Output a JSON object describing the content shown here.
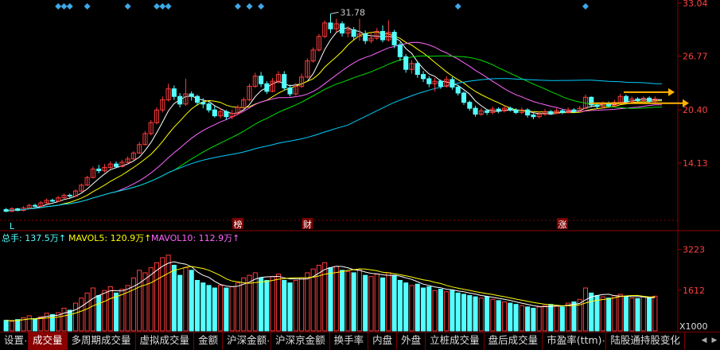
{
  "chart_data": {
    "type": "candlestick",
    "price_axis": {
      "ticks": [
        "33.04",
        "26.77",
        "20.40",
        "14.13"
      ],
      "ylim": [
        7.8,
        33.04
      ]
    },
    "max_label": "31.78",
    "event_markers": [
      "榜",
      "财",
      "涨"
    ],
    "left_marker": "L",
    "diamond_count": 13,
    "candles": [
      {
        "o": 8.6,
        "c": 8.4,
        "h": 8.8,
        "l": 8.3
      },
      {
        "o": 8.4,
        "c": 8.7,
        "h": 8.9,
        "l": 8.3
      },
      {
        "o": 8.7,
        "c": 8.5,
        "h": 8.8,
        "l": 8.4
      },
      {
        "o": 8.5,
        "c": 8.8,
        "h": 9.0,
        "l": 8.4
      },
      {
        "o": 8.8,
        "c": 9.1,
        "h": 9.3,
        "l": 8.7
      },
      {
        "o": 9.1,
        "c": 9.0,
        "h": 9.3,
        "l": 8.9
      },
      {
        "o": 9.0,
        "c": 9.4,
        "h": 9.6,
        "l": 8.9
      },
      {
        "o": 9.4,
        "c": 9.7,
        "h": 9.9,
        "l": 9.3
      },
      {
        "o": 9.7,
        "c": 9.6,
        "h": 9.9,
        "l": 9.5
      },
      {
        "o": 9.6,
        "c": 10.0,
        "h": 10.2,
        "l": 9.5
      },
      {
        "o": 10.0,
        "c": 10.3,
        "h": 10.5,
        "l": 9.9
      },
      {
        "o": 10.3,
        "c": 10.2,
        "h": 10.5,
        "l": 10.0
      },
      {
        "o": 10.2,
        "c": 10.8,
        "h": 11.0,
        "l": 10.1
      },
      {
        "o": 10.8,
        "c": 11.5,
        "h": 11.7,
        "l": 10.7
      },
      {
        "o": 11.5,
        "c": 12.4,
        "h": 12.6,
        "l": 11.4
      },
      {
        "o": 12.4,
        "c": 13.4,
        "h": 13.7,
        "l": 12.3
      },
      {
        "o": 13.4,
        "c": 13.2,
        "h": 13.9,
        "l": 12.9
      },
      {
        "o": 13.2,
        "c": 13.6,
        "h": 14.0,
        "l": 13.0
      },
      {
        "o": 13.6,
        "c": 14.0,
        "h": 14.3,
        "l": 13.4
      },
      {
        "o": 14.0,
        "c": 13.7,
        "h": 14.3,
        "l": 13.5
      },
      {
        "o": 13.7,
        "c": 14.2,
        "h": 14.5,
        "l": 13.6
      },
      {
        "o": 14.2,
        "c": 14.6,
        "h": 14.9,
        "l": 14.0
      },
      {
        "o": 14.6,
        "c": 15.3,
        "h": 15.5,
        "l": 14.5
      },
      {
        "o": 15.3,
        "c": 16.3,
        "h": 16.6,
        "l": 15.2
      },
      {
        "o": 16.3,
        "c": 17.6,
        "h": 17.9,
        "l": 16.2
      },
      {
        "o": 17.6,
        "c": 18.9,
        "h": 19.2,
        "l": 17.4
      },
      {
        "o": 18.9,
        "c": 20.4,
        "h": 20.7,
        "l": 18.7
      },
      {
        "o": 20.4,
        "c": 21.6,
        "h": 22.0,
        "l": 20.1
      },
      {
        "o": 21.6,
        "c": 22.9,
        "h": 23.5,
        "l": 21.4
      },
      {
        "o": 22.9,
        "c": 22.0,
        "h": 23.3,
        "l": 21.6
      },
      {
        "o": 22.0,
        "c": 21.1,
        "h": 22.4,
        "l": 20.7
      },
      {
        "o": 21.1,
        "c": 22.3,
        "h": 24.1,
        "l": 20.9
      },
      {
        "o": 22.3,
        "c": 22.0,
        "h": 22.6,
        "l": 21.5
      },
      {
        "o": 22.0,
        "c": 21.3,
        "h": 22.2,
        "l": 20.9
      },
      {
        "o": 21.3,
        "c": 21.1,
        "h": 21.8,
        "l": 20.6
      },
      {
        "o": 21.1,
        "c": 20.4,
        "h": 21.3,
        "l": 20.1
      },
      {
        "o": 20.4,
        "c": 19.7,
        "h": 20.9,
        "l": 19.5
      },
      {
        "o": 19.7,
        "c": 20.2,
        "h": 20.6,
        "l": 19.4
      },
      {
        "o": 20.2,
        "c": 19.6,
        "h": 20.4,
        "l": 19.2
      },
      {
        "o": 19.6,
        "c": 20.0,
        "h": 20.4,
        "l": 19.3
      },
      {
        "o": 20.0,
        "c": 20.7,
        "h": 21.0,
        "l": 19.8
      },
      {
        "o": 20.7,
        "c": 21.6,
        "h": 21.9,
        "l": 20.5
      },
      {
        "o": 21.6,
        "c": 23.2,
        "h": 23.5,
        "l": 21.4
      },
      {
        "o": 23.2,
        "c": 24.4,
        "h": 24.8,
        "l": 23.0
      },
      {
        "o": 24.4,
        "c": 23.5,
        "h": 24.9,
        "l": 23.1
      },
      {
        "o": 23.5,
        "c": 22.6,
        "h": 23.8,
        "l": 22.3
      },
      {
        "o": 22.6,
        "c": 23.8,
        "h": 24.2,
        "l": 22.5
      },
      {
        "o": 23.8,
        "c": 24.6,
        "h": 25.0,
        "l": 23.5
      },
      {
        "o": 24.6,
        "c": 23.0,
        "h": 25.0,
        "l": 22.7
      },
      {
        "o": 23.0,
        "c": 22.3,
        "h": 23.4,
        "l": 22.0
      },
      {
        "o": 22.3,
        "c": 23.2,
        "h": 23.6,
        "l": 22.1
      },
      {
        "o": 23.2,
        "c": 24.3,
        "h": 24.7,
        "l": 23.0
      },
      {
        "o": 24.3,
        "c": 26.2,
        "h": 26.5,
        "l": 24.1
      },
      {
        "o": 26.2,
        "c": 27.5,
        "h": 27.8,
        "l": 26.0
      },
      {
        "o": 27.5,
        "c": 29.1,
        "h": 29.4,
        "l": 27.3
      },
      {
        "o": 29.1,
        "c": 30.7,
        "h": 31.0,
        "l": 28.9
      },
      {
        "o": 30.7,
        "c": 30.0,
        "h": 31.78,
        "l": 29.5
      },
      {
        "o": 30.0,
        "c": 30.6,
        "h": 31.2,
        "l": 29.6
      },
      {
        "o": 30.6,
        "c": 29.5,
        "h": 30.9,
        "l": 29.1
      },
      {
        "o": 29.5,
        "c": 29.9,
        "h": 30.3,
        "l": 29.0
      },
      {
        "o": 29.9,
        "c": 29.1,
        "h": 30.2,
        "l": 28.7
      },
      {
        "o": 29.1,
        "c": 29.4,
        "h": 31.2,
        "l": 28.6
      },
      {
        "o": 29.4,
        "c": 28.6,
        "h": 29.8,
        "l": 28.2
      },
      {
        "o": 28.6,
        "c": 28.9,
        "h": 29.6,
        "l": 28.3
      },
      {
        "o": 28.9,
        "c": 29.7,
        "h": 30.1,
        "l": 28.7
      },
      {
        "o": 29.7,
        "c": 28.7,
        "h": 30.4,
        "l": 28.4
      },
      {
        "o": 28.7,
        "c": 29.6,
        "h": 31.0,
        "l": 28.5
      },
      {
        "o": 29.6,
        "c": 28.1,
        "h": 29.9,
        "l": 27.7
      },
      {
        "o": 28.1,
        "c": 26.7,
        "h": 28.4,
        "l": 26.2
      },
      {
        "o": 26.7,
        "c": 25.2,
        "h": 27.0,
        "l": 24.8
      },
      {
        "o": 25.2,
        "c": 25.9,
        "h": 26.3,
        "l": 24.7
      },
      {
        "o": 25.9,
        "c": 24.6,
        "h": 26.2,
        "l": 24.2
      },
      {
        "o": 24.6,
        "c": 24.1,
        "h": 25.0,
        "l": 23.7
      },
      {
        "o": 24.1,
        "c": 23.5,
        "h": 24.4,
        "l": 23.1
      },
      {
        "o": 23.5,
        "c": 23.8,
        "h": 24.2,
        "l": 22.6
      },
      {
        "o": 23.8,
        "c": 23.2,
        "h": 24.0,
        "l": 22.9
      },
      {
        "o": 23.2,
        "c": 24.0,
        "h": 24.4,
        "l": 23.0
      },
      {
        "o": 24.0,
        "c": 23.1,
        "h": 24.3,
        "l": 22.8
      },
      {
        "o": 23.1,
        "c": 22.4,
        "h": 23.4,
        "l": 22.1
      },
      {
        "o": 22.4,
        "c": 21.3,
        "h": 22.6,
        "l": 21.0
      },
      {
        "o": 21.3,
        "c": 20.6,
        "h": 21.5,
        "l": 20.3
      },
      {
        "o": 20.6,
        "c": 19.9,
        "h": 20.9,
        "l": 19.6
      },
      {
        "o": 19.9,
        "c": 20.3,
        "h": 20.6,
        "l": 19.7
      },
      {
        "o": 20.3,
        "c": 20.1,
        "h": 20.5,
        "l": 19.8
      },
      {
        "o": 20.1,
        "c": 20.5,
        "h": 20.8,
        "l": 19.9
      },
      {
        "o": 20.5,
        "c": 20.3,
        "h": 20.7,
        "l": 20.0
      },
      {
        "o": 20.3,
        "c": 20.6,
        "h": 20.9,
        "l": 20.1
      },
      {
        "o": 20.6,
        "c": 20.4,
        "h": 20.8,
        "l": 20.2
      },
      {
        "o": 20.4,
        "c": 20.1,
        "h": 20.6,
        "l": 19.9
      },
      {
        "o": 20.1,
        "c": 20.4,
        "h": 20.7,
        "l": 19.9
      },
      {
        "o": 20.4,
        "c": 19.8,
        "h": 20.6,
        "l": 19.5
      },
      {
        "o": 19.8,
        "c": 19.6,
        "h": 20.0,
        "l": 19.3
      },
      {
        "o": 19.6,
        "c": 19.9,
        "h": 20.2,
        "l": 19.4
      },
      {
        "o": 19.9,
        "c": 20.2,
        "h": 20.5,
        "l": 19.7
      },
      {
        "o": 20.2,
        "c": 20.0,
        "h": 20.4,
        "l": 19.8
      },
      {
        "o": 20.0,
        "c": 20.3,
        "h": 20.6,
        "l": 19.9
      },
      {
        "o": 20.3,
        "c": 20.1,
        "h": 20.5,
        "l": 19.9
      },
      {
        "o": 20.1,
        "c": 20.4,
        "h": 20.7,
        "l": 20.0
      },
      {
        "o": 20.4,
        "c": 20.2,
        "h": 20.6,
        "l": 20.0
      },
      {
        "o": 20.2,
        "c": 20.6,
        "h": 20.9,
        "l": 20.1
      },
      {
        "o": 20.6,
        "c": 21.9,
        "h": 22.2,
        "l": 20.5
      },
      {
        "o": 21.9,
        "c": 21.0,
        "h": 22.0,
        "l": 20.7
      },
      {
        "o": 21.0,
        "c": 20.8,
        "h": 21.3,
        "l": 20.6
      },
      {
        "o": 20.8,
        "c": 21.1,
        "h": 21.4,
        "l": 20.6
      },
      {
        "o": 21.1,
        "c": 20.9,
        "h": 21.4,
        "l": 20.7
      },
      {
        "o": 20.9,
        "c": 21.3,
        "h": 21.6,
        "l": 20.8
      },
      {
        "o": 21.3,
        "c": 22.0,
        "h": 22.3,
        "l": 21.1
      },
      {
        "o": 22.0,
        "c": 21.4,
        "h": 22.2,
        "l": 21.2
      },
      {
        "o": 21.4,
        "c": 21.7,
        "h": 22.0,
        "l": 21.2
      },
      {
        "o": 21.7,
        "c": 21.5,
        "h": 21.9,
        "l": 21.3
      },
      {
        "o": 21.5,
        "c": 21.8,
        "h": 22.0,
        "l": 21.3
      },
      {
        "o": 21.8,
        "c": 21.4,
        "h": 22.0,
        "l": 21.2
      },
      {
        "o": 21.4,
        "c": 21.7,
        "h": 22.0,
        "l": 21.2
      }
    ],
    "volume": {
      "label": "总手: 137.5万↑",
      "mavol5": "MAVOL5: 120.9万↑",
      "mavol10": "MAVOL10: 112.9万↑",
      "ticks": [
        "3223",
        "1612",
        "X1000"
      ],
      "ylim": [
        0,
        3400
      ],
      "values": [
        420,
        380,
        450,
        520,
        600,
        480,
        560,
        700,
        650,
        720,
        900,
        820,
        1100,
        1300,
        1500,
        1700,
        1400,
        1600,
        1750,
        1500,
        1650,
        1800,
        2100,
        2400,
        2300,
        2500,
        2700,
        2900,
        3000,
        2600,
        2200,
        2500,
        2400,
        2000,
        1900,
        1800,
        1700,
        1800,
        1700,
        1750,
        1900,
        2100,
        2200,
        2300,
        2100,
        2000,
        2150,
        2250,
        2000,
        1900,
        2000,
        2100,
        2300,
        2450,
        2600,
        2700,
        2500,
        2550,
        2400,
        2350,
        2300,
        2400,
        2200,
        2150,
        2250,
        2100,
        2300,
        2200,
        2000,
        1900,
        1800,
        1850,
        1700,
        1750,
        1600,
        1650,
        1550,
        1600,
        1500,
        1450,
        1400,
        1350,
        1300,
        1350,
        1250,
        1200,
        1150,
        1100,
        1050,
        1000,
        950,
        900,
        950,
        1000,
        1050,
        1000,
        950,
        1100,
        1150,
        1250,
        1700,
        1500,
        1400,
        1350,
        1300,
        1400,
        1450,
        1350,
        1300,
        1280,
        1350,
        1300,
        1375
      ]
    }
  },
  "tabs": [
    {
      "label": "设置",
      "dot": true
    },
    {
      "label": "成交量",
      "dot": false,
      "active": true
    },
    {
      "label": "多周期成交量",
      "dot": false
    },
    {
      "label": "虚拟成交量",
      "dot": false
    },
    {
      "label": "金额",
      "dot": false
    },
    {
      "label": "沪深金额",
      "dot": true
    },
    {
      "label": "沪深京金额",
      "dot": false
    },
    {
      "label": "换手率",
      "dot": false
    },
    {
      "label": "内盘",
      "dot": false
    },
    {
      "label": "外盘",
      "dot": false
    },
    {
      "label": "立桩成交量",
      "dot": false
    },
    {
      "label": "盘后成交量",
      "dot": false
    },
    {
      "label": "市盈率(ttm)",
      "dot": true
    },
    {
      "label": "陆股通持股变化",
      "dot": false
    }
  ],
  "nav": {
    "left": "◀",
    "right": "▶"
  },
  "colors": {
    "up": "#ff3c3c",
    "down": "#54ffff",
    "ma5": "#ffffff",
    "ma10": "#ffff00",
    "ma20": "#ff66ff",
    "ma30": "#00e000",
    "ma60": "#00ccff",
    "arrow": "#ffb300",
    "grid": "#8a0000"
  }
}
